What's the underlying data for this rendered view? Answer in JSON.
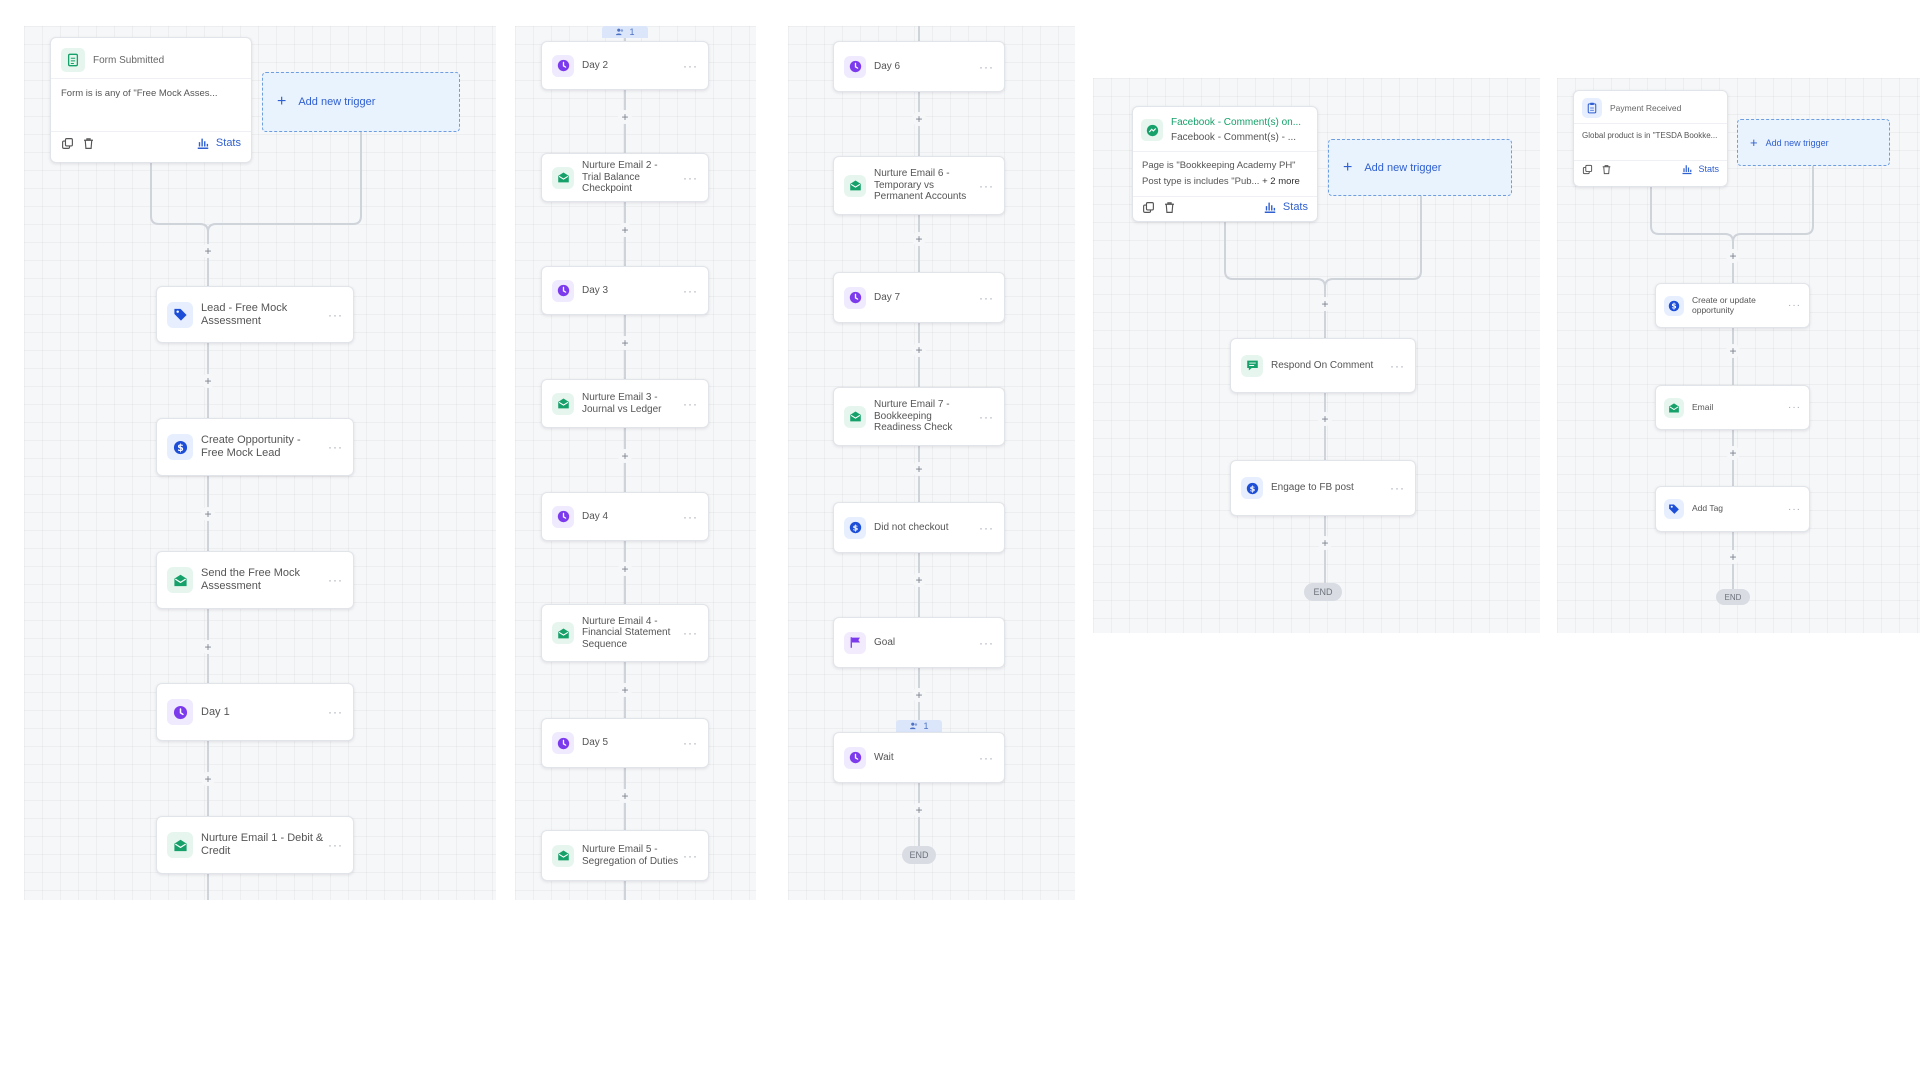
{
  "panel1": {
    "trigger": {
      "title": "Form Submitted",
      "condition": "Form is is any of \"Free Mock Asses...",
      "stats_label": "Stats"
    },
    "add_trigger_label": "Add new trigger",
    "steps": [
      {
        "label": "Lead - Free Mock Assessment",
        "icon": "tag-icon"
      },
      {
        "label": "Create Opportunity - Free Mock Lead",
        "icon": "dollar-icon"
      },
      {
        "label": "Send the Free Mock Assessment",
        "icon": "email-icon"
      },
      {
        "label": "Day 1",
        "icon": "clock-icon"
      },
      {
        "label": "Nurture Email 1 - Debit & Credit",
        "icon": "email-icon"
      }
    ]
  },
  "panel2": {
    "badge": "1",
    "steps": [
      {
        "label": "Day 2",
        "icon": "clock-icon"
      },
      {
        "label": "Nurture Email 2 - Trial Balance Checkpoint",
        "icon": "email-icon"
      },
      {
        "label": "Day 3",
        "icon": "clock-icon"
      },
      {
        "label": "Nurture Email 3 - Journal vs Ledger",
        "icon": "email-icon"
      },
      {
        "label": "Day 4",
        "icon": "clock-icon"
      },
      {
        "label": "Nurture Email 4 - Financial Statement Sequence",
        "icon": "email-icon"
      },
      {
        "label": "Day 5",
        "icon": "clock-icon"
      },
      {
        "label": "Nurture Email 5 - Segregation of Duties",
        "icon": "email-icon"
      }
    ]
  },
  "panel3": {
    "badge": "1",
    "end_label": "END",
    "steps": [
      {
        "label": "Day 6",
        "icon": "clock-icon"
      },
      {
        "label": "Nurture Email 6 - Temporary vs Permanent Accounts",
        "icon": "email-icon"
      },
      {
        "label": "Day 7",
        "icon": "clock-icon"
      },
      {
        "label": "Nurture Email 7 - Bookkeeping Readiness Check",
        "icon": "email-icon"
      },
      {
        "label": "Did not checkout",
        "icon": "dollar-icon"
      },
      {
        "label": "Goal",
        "icon": "flag-icon"
      },
      {
        "label": "Wait",
        "icon": "clock-icon"
      }
    ]
  },
  "panel4": {
    "trigger": {
      "title": "Facebook - Comment(s) on...",
      "subtitle": "Facebook - Comment(s) - ...",
      "condition_1": "Page is \"Bookkeeping Academy PH\"",
      "condition_2": "Post type is includes \"Pub...",
      "condition_2_more": "+ 2 more",
      "stats_label": "Stats"
    },
    "add_trigger_label": "Add new trigger",
    "end_label": "END",
    "steps": [
      {
        "label": "Respond On Comment",
        "icon": "comment-icon"
      },
      {
        "label": "Engage to FB post",
        "icon": "dollar-icon"
      }
    ]
  },
  "panel5": {
    "trigger": {
      "title": "Payment Received",
      "condition": "Global product is in \"TESDA Bookke...",
      "stats_label": "Stats"
    },
    "add_trigger_label": "Add new trigger",
    "end_label": "END",
    "steps": [
      {
        "label": "Create or update opportunity",
        "icon": "dollar-icon"
      },
      {
        "label": "Email",
        "icon": "email-icon"
      },
      {
        "label": "Add Tag",
        "icon": "tag-icon"
      }
    ]
  },
  "colors": {
    "green": "#16a06a",
    "purple": "#7c3aed",
    "blue": "#1d4ed8",
    "link": "#2f5fd0",
    "dashed_border": "#6f9ee0"
  }
}
